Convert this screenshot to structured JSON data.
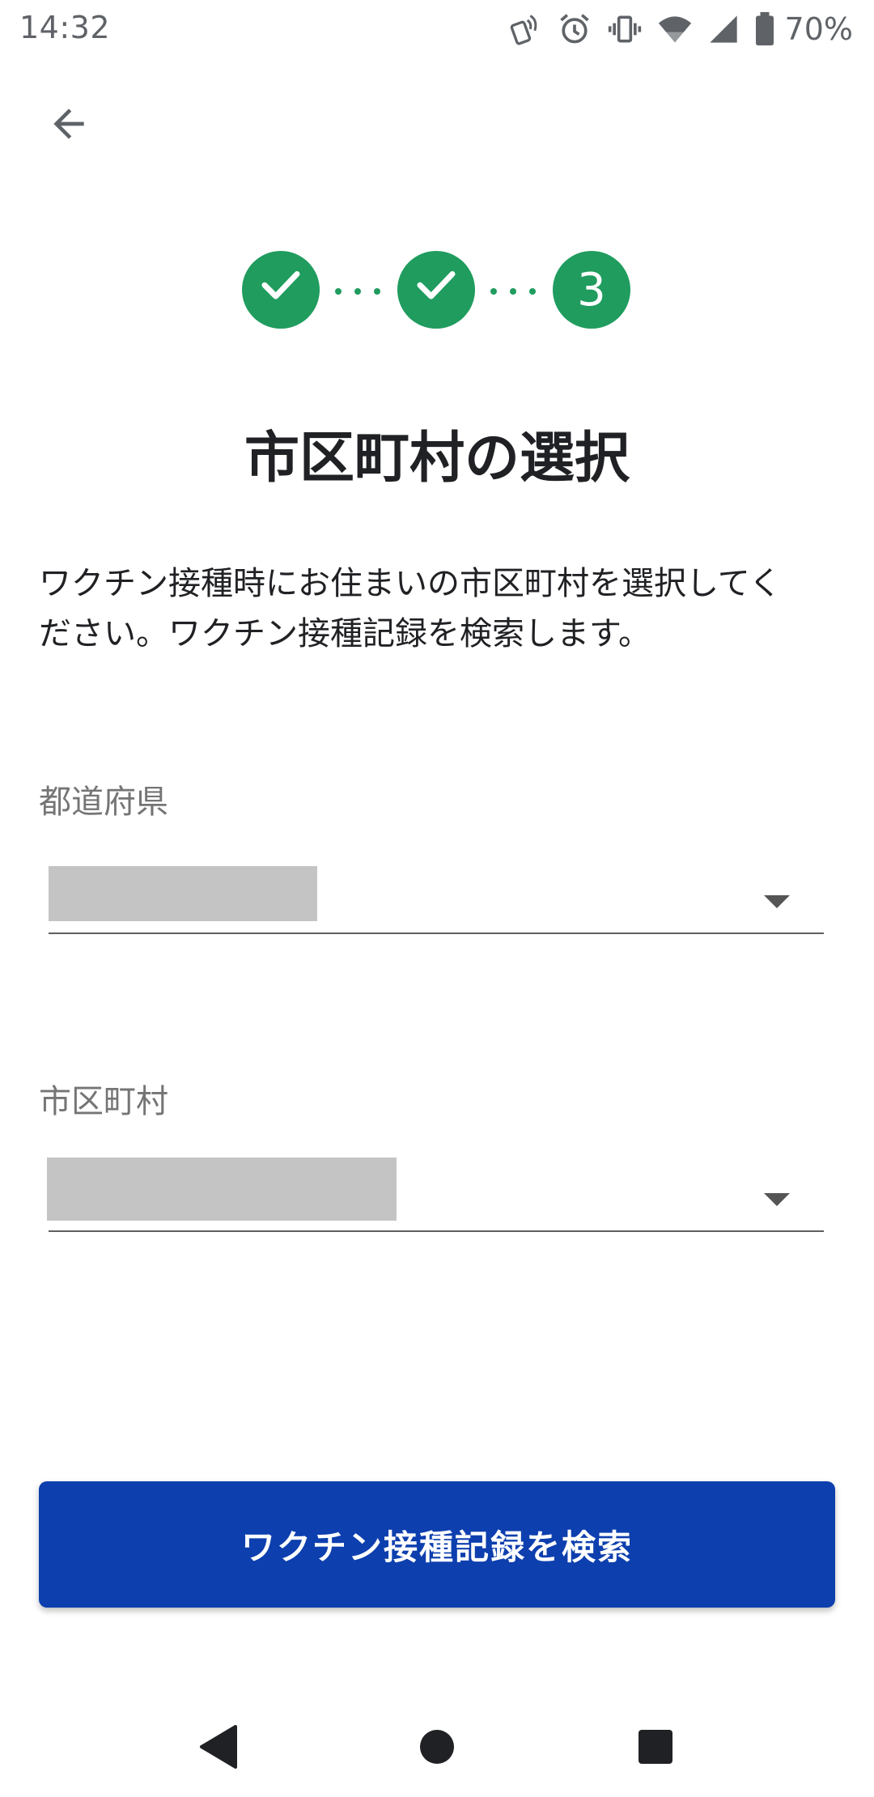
{
  "status_bar": {
    "time": "14:32",
    "battery_percent": "70%",
    "icons": [
      "nfc-icon",
      "alarm-icon",
      "vibrate-icon",
      "wifi-icon",
      "cell-signal-icon",
      "battery-icon"
    ]
  },
  "header": {
    "back_icon": "arrow-left-icon"
  },
  "stepper": {
    "steps": [
      {
        "state": "completed",
        "icon": "check-icon"
      },
      {
        "state": "completed",
        "icon": "check-icon"
      },
      {
        "state": "current",
        "label": "3"
      }
    ],
    "color": "#1f9c5e"
  },
  "main": {
    "title": "市区町村の選択",
    "description_line1": "ワクチン接種時にお住まいの市区町村を選択してく",
    "description_line2": "ださい。ワクチン接種記録を検索します。",
    "prefecture": {
      "label": "都道府県"
    },
    "municipality": {
      "label": "市区町村"
    },
    "search_button_label": "ワクチン接種記録を検索",
    "button_color": "#0d3fae"
  },
  "nav_bar": {
    "items": [
      "back-triangle-icon",
      "home-circle-icon",
      "recents-square-icon"
    ]
  }
}
